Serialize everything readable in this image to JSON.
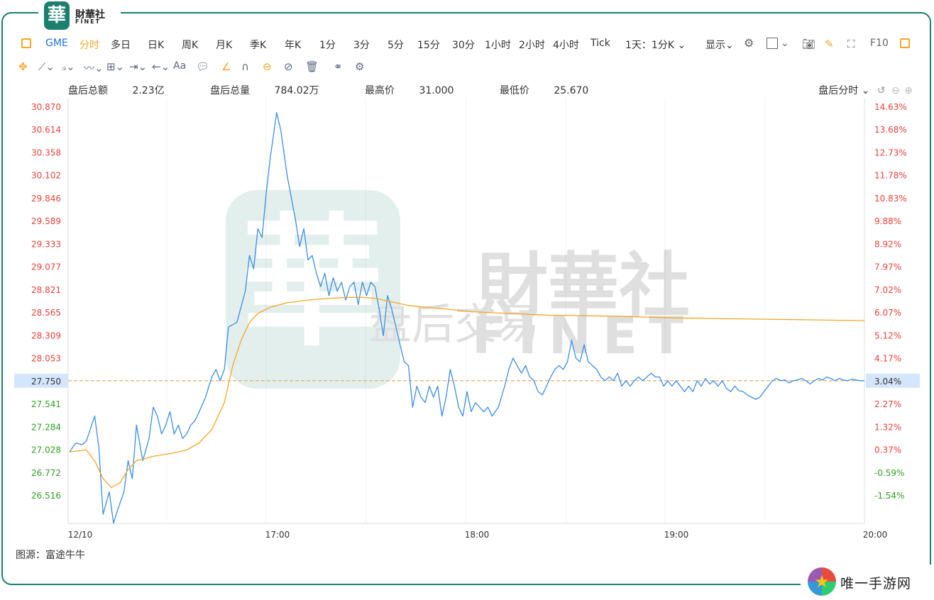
{
  "logo": {
    "char": "華",
    "cn": "財華社",
    "en": "FINET"
  },
  "toolbar": {
    "symbol": "GME",
    "periods": [
      "分时",
      "多日",
      "日K",
      "周K",
      "月K",
      "季K",
      "年K",
      "1分",
      "3分",
      "5分",
      "15分",
      "30分",
      "1小时",
      "2小时",
      "4小时",
      "Tick"
    ],
    "active_period": "分时",
    "range": "1天：1分K",
    "display": "显示",
    "f10": "F10"
  },
  "toolbar2": {
    "text_tool": "Aa"
  },
  "info": {
    "turnover_label": "盘后总额",
    "turnover": "2.23亿",
    "volume_label": "盘后总量",
    "volume": "784.02万",
    "high_label": "最高价",
    "high": "31.000",
    "low_label": "最低价",
    "low": "25.670"
  },
  "session_select": "盘后分时",
  "source": "图源：富途牛牛",
  "site_watermark": "唯一手游网",
  "chart_data": {
    "type": "line",
    "title": "",
    "xlabel": "",
    "ylabel": "",
    "x_ticks": [
      "12/10",
      "17:00",
      "18:00",
      "19:00",
      "20:00"
    ],
    "y_ticks_left": [
      "30.870",
      "30.614",
      "30.358",
      "30.102",
      "29.846",
      "29.589",
      "29.333",
      "29.077",
      "28.821",
      "28.565",
      "28.309",
      "28.053",
      "27.750",
      "27.541",
      "27.284",
      "27.028",
      "26.772",
      "26.516"
    ],
    "y_ticks_right": [
      "14.63%",
      "13.68%",
      "12.73%",
      "11.78%",
      "10.83%",
      "9.88%",
      "8.92%",
      "7.97%",
      "7.02%",
      "6.07%",
      "5.12%",
      "4.17%",
      "3.04%",
      "2.27%",
      "1.32%",
      "0.37%",
      "-0.59%",
      "-1.54%"
    ],
    "current_price": "27.750",
    "current_pct": "3.04%",
    "ylim": [
      26.25,
      31.0
    ],
    "watermark": {
      "brand": "財華社",
      "brand_en": "FINET",
      "label": "盘后交易"
    },
    "colors": {
      "price": "#3a8ee6",
      "avg": "#f5a623",
      "up": "#e8413c",
      "down": "#2ea121",
      "ref": "#f0a050"
    },
    "series": [
      {
        "values": [
          [
            0,
            27.0
          ],
          [
            3,
            27.1
          ],
          [
            6,
            27.08
          ],
          [
            8,
            27.12
          ],
          [
            12,
            27.4
          ],
          [
            14,
            27.05
          ],
          [
            16,
            26.3
          ],
          [
            19,
            26.55
          ],
          [
            21,
            26.2
          ],
          [
            23,
            26.35
          ],
          [
            26,
            26.55
          ],
          [
            28,
            26.9
          ],
          [
            30,
            26.7
          ],
          [
            32,
            27.3
          ],
          [
            35,
            26.9
          ],
          [
            38,
            27.15
          ],
          [
            40,
            27.5
          ],
          [
            42,
            27.4
          ],
          [
            44,
            27.2
          ],
          [
            46,
            27.3
          ],
          [
            48,
            27.45
          ],
          [
            50,
            27.2
          ],
          [
            52,
            27.3
          ],
          [
            54,
            27.15
          ],
          [
            56,
            27.2
          ],
          [
            58,
            27.3
          ],
          [
            60,
            27.35
          ],
          [
            62,
            27.45
          ],
          [
            65,
            27.6
          ],
          [
            68,
            27.8
          ],
          [
            70,
            27.9
          ],
          [
            72,
            27.75
          ],
          [
            74,
            27.9
          ],
          [
            76,
            28.4
          ],
          [
            80,
            28.45
          ],
          [
            84,
            28.8
          ],
          [
            86,
            29.2
          ],
          [
            88,
            29.05
          ],
          [
            90,
            29.5
          ],
          [
            92,
            29.4
          ],
          [
            94,
            29.9
          ],
          [
            96,
            30.3
          ],
          [
            99,
            30.8
          ],
          [
            101,
            30.6
          ],
          [
            104,
            30.1
          ],
          [
            106,
            29.85
          ],
          [
            108,
            29.6
          ],
          [
            110,
            29.3
          ],
          [
            112,
            29.5
          ],
          [
            114,
            29.15
          ],
          [
            116,
            29.2
          ],
          [
            118,
            29.0
          ],
          [
            120,
            28.85
          ],
          [
            122,
            29.0
          ],
          [
            124,
            28.75
          ],
          [
            126,
            28.95
          ],
          [
            128,
            28.8
          ],
          [
            130,
            28.9
          ],
          [
            132,
            28.7
          ],
          [
            134,
            28.85
          ],
          [
            136,
            28.9
          ],
          [
            138,
            28.65
          ],
          [
            140,
            28.9
          ],
          [
            142,
            28.75
          ],
          [
            144,
            28.9
          ],
          [
            146,
            28.85
          ],
          [
            148,
            28.6
          ],
          [
            150,
            28.3
          ],
          [
            152,
            28.75
          ],
          [
            154,
            28.6
          ],
          [
            156,
            28.4
          ],
          [
            158,
            28.2
          ],
          [
            160,
            28.0
          ],
          [
            162,
            27.95
          ],
          [
            164,
            27.5
          ],
          [
            166,
            27.7
          ],
          [
            168,
            27.6
          ],
          [
            170,
            27.55
          ],
          [
            172,
            27.7
          ],
          [
            174,
            27.6
          ],
          [
            176,
            27.7
          ],
          [
            178,
            27.4
          ],
          [
            180,
            27.6
          ],
          [
            182,
            27.9
          ],
          [
            184,
            27.7
          ],
          [
            186,
            27.5
          ],
          [
            188,
            27.4
          ],
          [
            190,
            27.65
          ],
          [
            192,
            27.45
          ],
          [
            194,
            27.55
          ],
          [
            196,
            27.5
          ],
          [
            198,
            27.45
          ],
          [
            200,
            27.5
          ],
          [
            202,
            27.4
          ],
          [
            205,
            27.5
          ],
          [
            208,
            27.7
          ],
          [
            210,
            27.9
          ],
          [
            212,
            28.05
          ],
          [
            214,
            27.95
          ],
          [
            216,
            27.85
          ],
          [
            218,
            27.95
          ],
          [
            220,
            27.8
          ],
          [
            222,
            27.75
          ],
          [
            224,
            27.65
          ],
          [
            226,
            27.62
          ],
          [
            228,
            27.7
          ],
          [
            230,
            27.8
          ],
          [
            232,
            27.9
          ],
          [
            234,
            27.95
          ],
          [
            236,
            27.9
          ],
          [
            238,
            28.0
          ],
          [
            240,
            28.25
          ],
          [
            242,
            28.05
          ],
          [
            244,
            28.0
          ],
          [
            246,
            28.2
          ],
          [
            248,
            28.0
          ],
          [
            250,
            27.95
          ],
          [
            252,
            27.9
          ],
          [
            254,
            27.8
          ],
          [
            256,
            27.75
          ],
          [
            258,
            27.8
          ],
          [
            260,
            27.75
          ],
          [
            262,
            27.85
          ],
          [
            264,
            27.7
          ],
          [
            266,
            27.75
          ],
          [
            268,
            27.7
          ],
          [
            270,
            27.75
          ],
          [
            272,
            27.8
          ],
          [
            274,
            27.75
          ],
          [
            276,
            27.8
          ],
          [
            278,
            27.85
          ],
          [
            280,
            27.8
          ],
          [
            282,
            27.8
          ],
          [
            284,
            27.7
          ],
          [
            286,
            27.75
          ],
          [
            288,
            27.7
          ],
          [
            290,
            27.75
          ],
          [
            292,
            27.7
          ],
          [
            294,
            27.65
          ],
          [
            296,
            27.7
          ],
          [
            298,
            27.65
          ],
          [
            300,
            27.75
          ],
          [
            302,
            27.7
          ],
          [
            304,
            27.78
          ],
          [
            306,
            27.72
          ],
          [
            308,
            27.75
          ],
          [
            310,
            27.7
          ],
          [
            312,
            27.75
          ],
          [
            314,
            27.68
          ],
          [
            316,
            27.65
          ],
          [
            318,
            27.7
          ],
          [
            320,
            27.66
          ],
          [
            322,
            27.65
          ],
          [
            324,
            27.62
          ],
          [
            326,
            27.6
          ],
          [
            328,
            27.58
          ],
          [
            330,
            27.6
          ],
          [
            332,
            27.65
          ],
          [
            334,
            27.7
          ],
          [
            336,
            27.75
          ],
          [
            338,
            27.78
          ],
          [
            340,
            27.75
          ],
          [
            342,
            27.76
          ],
          [
            344,
            27.73
          ],
          [
            346,
            27.75
          ],
          [
            348,
            27.76
          ],
          [
            350,
            27.78
          ],
          [
            352,
            27.75
          ],
          [
            354,
            27.72
          ],
          [
            356,
            27.75
          ],
          [
            358,
            27.78
          ],
          [
            360,
            27.76
          ],
          [
            362,
            27.8
          ],
          [
            364,
            27.78
          ],
          [
            366,
            27.75
          ],
          [
            368,
            27.78
          ],
          [
            370,
            27.76
          ],
          [
            372,
            27.75
          ],
          [
            374,
            27.77
          ],
          [
            376,
            27.76
          ],
          [
            378,
            27.75
          ],
          [
            380,
            27.75
          ]
        ]
      },
      {
        "values": [
          [
            0,
            27.0
          ],
          [
            8,
            27.02
          ],
          [
            12,
            26.9
          ],
          [
            16,
            26.7
          ],
          [
            20,
            26.6
          ],
          [
            24,
            26.65
          ],
          [
            28,
            26.8
          ],
          [
            32,
            26.9
          ],
          [
            40,
            26.95
          ],
          [
            48,
            26.98
          ],
          [
            56,
            27.02
          ],
          [
            62,
            27.1
          ],
          [
            68,
            27.25
          ],
          [
            74,
            27.55
          ],
          [
            78,
            27.95
          ],
          [
            82,
            28.25
          ],
          [
            86,
            28.45
          ],
          [
            90,
            28.55
          ],
          [
            96,
            28.62
          ],
          [
            104,
            28.67
          ],
          [
            114,
            28.7
          ],
          [
            124,
            28.72
          ],
          [
            134,
            28.73
          ],
          [
            140,
            28.73
          ],
          [
            146,
            28.72
          ],
          [
            154,
            28.68
          ],
          [
            162,
            28.64
          ],
          [
            170,
            28.62
          ],
          [
            180,
            28.6
          ],
          [
            192,
            28.57
          ],
          [
            210,
            28.55
          ],
          [
            230,
            28.53
          ],
          [
            260,
            28.52
          ],
          [
            290,
            28.5
          ],
          [
            320,
            28.49
          ],
          [
            350,
            28.48
          ],
          [
            380,
            28.47
          ]
        ]
      }
    ]
  }
}
